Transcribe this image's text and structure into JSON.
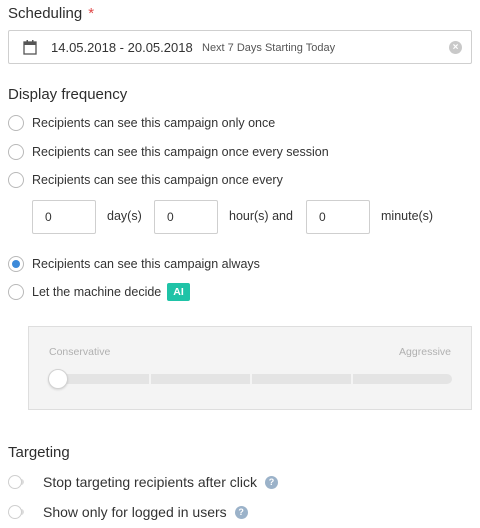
{
  "scheduling": {
    "title": "Scheduling",
    "required_mark": "*",
    "date_range": "14.05.2018 - 20.05.2018",
    "date_hint": "Next 7 Days Starting Today",
    "clear_icon": "×"
  },
  "display_frequency": {
    "title": "Display frequency",
    "options": [
      {
        "label": "Recipients can see this campaign only once",
        "checked": false
      },
      {
        "label": "Recipients can see this campaign once every session",
        "checked": false
      },
      {
        "label": "Recipients can see this campaign once every",
        "checked": false
      },
      {
        "label": "Recipients can see this campaign always",
        "checked": true
      },
      {
        "label": "Let the machine decide",
        "checked": false
      }
    ],
    "every": {
      "days": "0",
      "days_unit": "day(s)",
      "hours": "0",
      "hours_unit": "hour(s) and",
      "minutes": "0",
      "minutes_unit": "minute(s)"
    },
    "ai_badge": "AI",
    "slider": {
      "min_label": "Conservative",
      "max_label": "Aggressive",
      "value": 0
    }
  },
  "targeting": {
    "title": "Targeting",
    "toggles": [
      {
        "label": "Stop targeting recipients after click",
        "on": false,
        "help": "?"
      },
      {
        "label": "Show only for logged in users",
        "on": false,
        "help": "?"
      }
    ]
  },
  "colors": {
    "accent": "#3d8ad9",
    "ai_badge": "#1fc3a7",
    "required": "#e04848"
  }
}
